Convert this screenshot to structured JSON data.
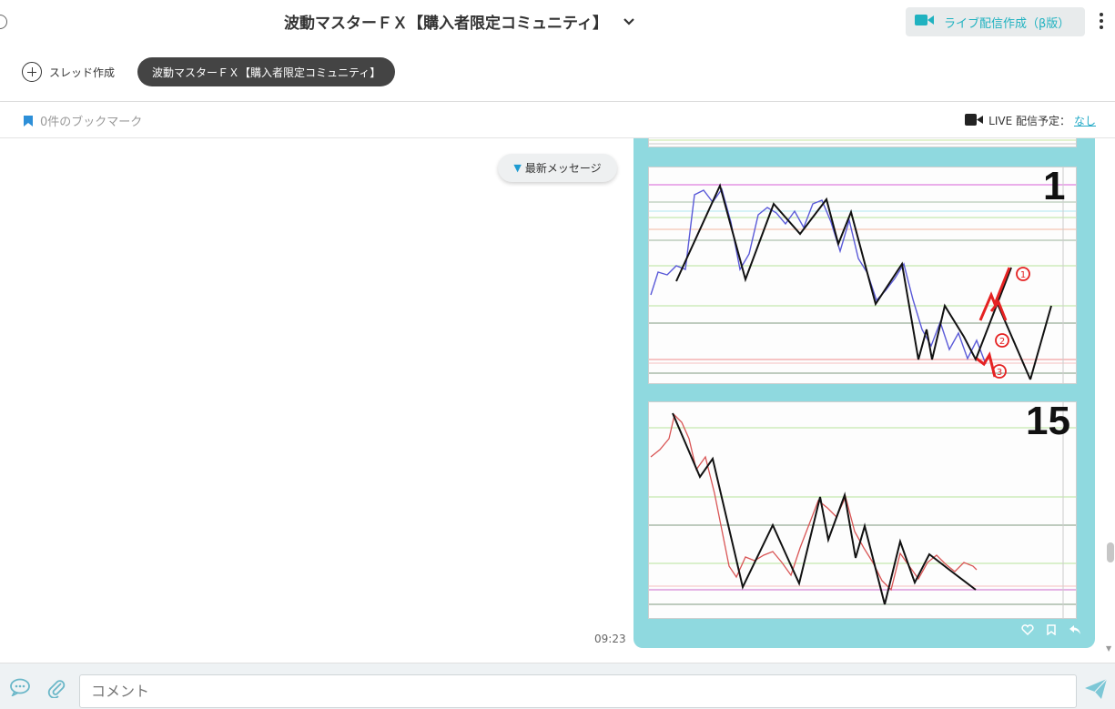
{
  "header": {
    "title": "波動マスターＦＸ【購入者限定コミュニティ】",
    "live_button_label": "ライブ配信作成（β版）"
  },
  "threads": {
    "new_thread_label": "スレッド作成",
    "active_thread_label": "波動マスターＦＸ【購入者限定コミュニティ】"
  },
  "info": {
    "bookmarks_label": "0件のブックマーク",
    "live_schedule_label": "LIVE 配信予定：",
    "live_schedule_value": "なし"
  },
  "chat": {
    "latest_messages_label": "最新メッセージ",
    "message_timestamp": "09:23",
    "chart_labels": [
      "1",
      "15"
    ]
  },
  "composer": {
    "placeholder": "コメント"
  },
  "colors": {
    "accent": "#20b2c0",
    "bubble": "#8fd9df",
    "pill": "#444444"
  }
}
